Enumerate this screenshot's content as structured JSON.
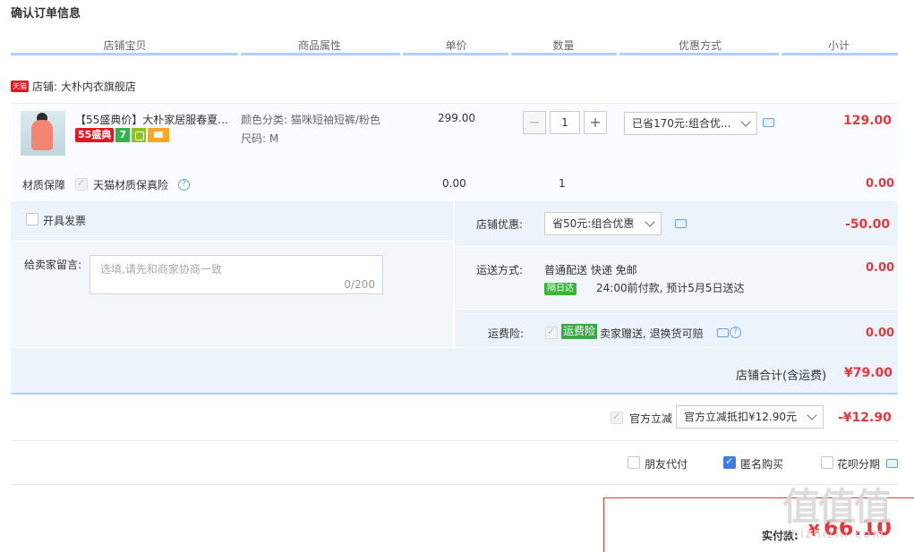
{
  "page": {
    "title": "确认订单信息"
  },
  "columns": [
    "店铺宝贝",
    "商品属性",
    "单价",
    "数量",
    "优惠方式",
    "小计"
  ],
  "shop": {
    "badge": "天猫",
    "label": "店铺: 大朴内衣旗舰店"
  },
  "item": {
    "title": "【55盛典价】大朴家居服春夏...",
    "tag_55": "55盛典",
    "tag_7": "7",
    "attr_color": "颜色分类: 猫咪短袖短裤/粉色",
    "attr_size": "尺码: M",
    "price": "299.00",
    "qty": "1",
    "qty_minus": "−",
    "qty_plus": "+",
    "discount": "已省170元:组合优...",
    "subtotal": "129.00"
  },
  "insurance": {
    "label": "材质保障",
    "option": "天猫材质保真险",
    "help": "?",
    "price": "0.00",
    "qty": "1",
    "subtotal": "0.00"
  },
  "invoice": {
    "label": "开具发票"
  },
  "message": {
    "label": "给卖家留言:",
    "placeholder": "选填,请先和商家协商一致",
    "counter": "0/200"
  },
  "shop_discount": {
    "label": "店铺优惠:",
    "value": "省50元:组合优惠",
    "amount": "-50.00"
  },
  "delivery": {
    "label": "运送方式:",
    "method": "普通配送 快递 免邮",
    "badge": "隔日达",
    "note": "24:00前付款, 预计5月5日送达",
    "amount": "0.00"
  },
  "freight": {
    "label": "运费险:",
    "badge": "运费险",
    "desc": "卖家赠送, 退换货可赔",
    "help": "?",
    "amount": "0.00"
  },
  "shop_total": {
    "label": "店铺合计(含运费)",
    "amount": "¥79.00"
  },
  "official": {
    "label": "官方立减",
    "value": "官方立减抵扣¥12.90元",
    "amount": "-¥12.90"
  },
  "options": {
    "friend_pay": "朋友代付",
    "anonymous": "匿名购买",
    "huabei": "花呗分期"
  },
  "pay": {
    "label": "实付款:",
    "currency": "¥",
    "amount": "66.10"
  },
  "watermark": {
    "text": "值值值",
    "url": "zhizhizhi.com"
  },
  "colors": {
    "accent_red": "#e4393c",
    "header_bar": "#b2d1ff",
    "panel_bg": "#edf3fb",
    "blue_check": "#3d7ce6"
  }
}
